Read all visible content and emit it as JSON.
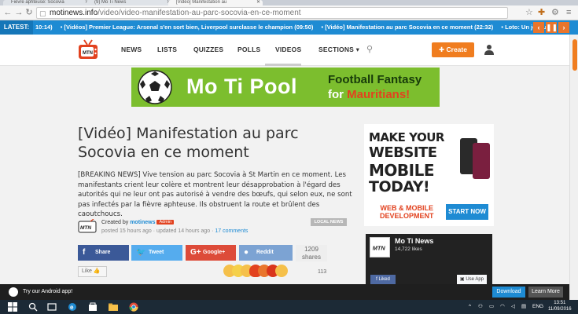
{
  "browser": {
    "tabs": [
      {
        "label": "Fièvre aphteuse: Socovia",
        "active": false
      },
      {
        "label": "(9) Mo Ti News",
        "active": false
      },
      {
        "label": "[Vidéo] Manifestation au",
        "active": true
      }
    ],
    "url_host": "motinews.info",
    "url_path": "/video/video-manifestation-au-parc-socovia-en-ce-moment"
  },
  "ticker": {
    "label": "LATEST:",
    "items": [
      "10:14)",
      "• [Vidéos] Premier League: Arsenal s'en sort bien, Liverpool surclasse le champion (09:50)",
      "• [Vidéo] Manifestation au parc Socovia en ce moment (22:32)",
      "• Loto: Un joueur"
    ]
  },
  "nav": {
    "items": [
      "NEWS",
      "LISTS",
      "QUIZZES",
      "POLLS",
      "VIDEOS",
      "SECTIONS ▾"
    ],
    "active": "VIDEOS",
    "create_label": "Create"
  },
  "banner": {
    "title": "Mo Ti Pool",
    "sub1": "Football Fantasy",
    "sub2_prefix": "for ",
    "sub2_highlight": "Mauritians!"
  },
  "article": {
    "title": "[Vidéo] Manifestation au parc Socovia en ce moment",
    "excerpt": "[BREAKING NEWS] Vive tension au parc Socovia à St Martin en ce moment. Les manifestants crient leur colère et montrent leur désapprobation à l'égard des autorités qui ne leur ont pas autorisé à vendre des bœufs, qui selon eux, ne sont pas infectés par la fièvre aphteuse. Ils obstruent la route et brûlent des caoutchoucs.",
    "created_by_prefix": "Created by ",
    "author": "motinews",
    "author_badge": "Admin",
    "meta_time": "posted 15 hours ago · updated 14 hours ago · ",
    "comments": "17 comments",
    "category": "LOCAL NEWS"
  },
  "share": {
    "facebook": "Share",
    "twitter": "Tweet",
    "googleplus": "Google+",
    "reddit": "Reddit",
    "count": "1209",
    "count_label": "shares",
    "like_label": "Like",
    "reactions_count": "113"
  },
  "ad": {
    "line1": "MAKE YOUR",
    "line2": "WEBSITE",
    "line3": "MOBILE",
    "line4": "TODAY!",
    "dev_line1": "WEB & MOBILE",
    "dev_line2": "DEVELOPMENT",
    "cta": "START NOW"
  },
  "fb_widget": {
    "name": "Mo Ti News",
    "likes": "14,722 likes",
    "liked_label": "Liked",
    "use_app_label": "Use App"
  },
  "android_bar": {
    "text": "Try our Android app!",
    "download": "Download",
    "learn_more": "Learn More"
  },
  "taskbar": {
    "lang": "ENG",
    "time": "13:51",
    "date": "11/09/2016"
  },
  "colors": {
    "accent_orange": "#f07d1f",
    "ticker_blue": "#1e8bd3",
    "banner_green": "#7cbe2e",
    "facebook": "#3b5998",
    "twitter": "#55acee",
    "googleplus": "#dd4b39",
    "reddit": "#7ca3d3"
  }
}
